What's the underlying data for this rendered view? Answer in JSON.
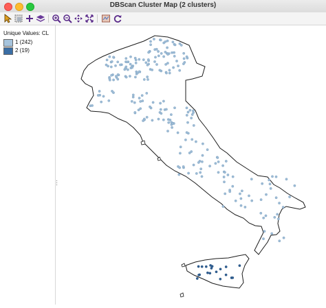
{
  "window": {
    "title": "DBScan Cluster Map (2 clusters)"
  },
  "toolbar": {
    "tools": [
      {
        "name": "select-tool-icon"
      },
      {
        "name": "rectangle-select-icon"
      },
      {
        "name": "add-layer-icon"
      },
      {
        "name": "layers-icon"
      },
      {
        "name": "zoom-in-icon"
      },
      {
        "name": "zoom-out-icon"
      },
      {
        "name": "pan-icon"
      },
      {
        "name": "full-extent-icon"
      },
      {
        "name": "basemap-icon"
      },
      {
        "name": "refresh-icon"
      }
    ]
  },
  "legend": {
    "title": "Unique Values: CL",
    "items": [
      {
        "label": "1 (242)",
        "color": "#a6c4dd"
      },
      {
        "label": "2 (19)",
        "color": "#3a6ea5"
      }
    ]
  },
  "map": {
    "outline_color": "#000000",
    "point_colors": {
      "cluster1": "#9dbcd6",
      "cluster2": "#2f5f93"
    }
  }
}
